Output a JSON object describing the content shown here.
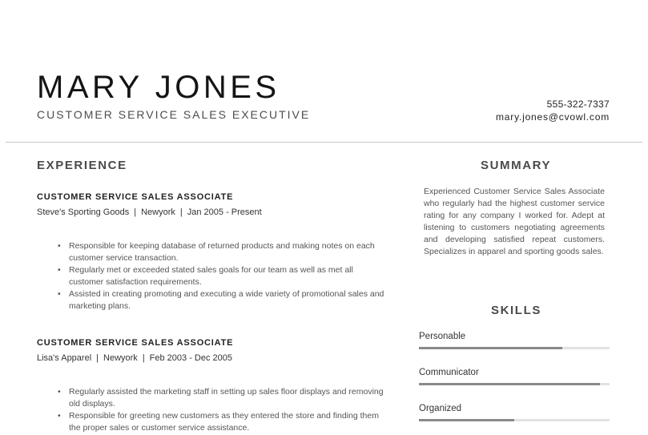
{
  "header": {
    "name": "MARY JONES",
    "title": "CUSTOMER SERVICE SALES EXECUTIVE",
    "phone": "555-322-7337",
    "email": "mary.jones@cvowl.com"
  },
  "experience": {
    "heading": "EXPERIENCE",
    "jobs": [
      {
        "title": "CUSTOMER SERVICE SALES ASSOCIATE",
        "company": "Steve's Sporting Goods",
        "location": "Newyork",
        "dates": "Jan 2005 - Present",
        "bullets": [
          "Responsible for keeping database of returned products and making notes on each customer service transaction.",
          "Regularly met or exceeded stated sales goals for our team as well as met all customer satisfaction requirements.",
          "Assisted in creating promoting and executing a wide variety of promotional sales and marketing plans."
        ]
      },
      {
        "title": "CUSTOMER SERVICE SALES ASSOCIATE",
        "company": "Lisa's Apparel",
        "location": "Newyork",
        "dates": "Feb 2003 - Dec 2005",
        "bullets": [
          "Regularly assisted the marketing staff in setting up sales floor displays and removing old displays.",
          "Responsible for greeting new customers as they entered the store and finding them the proper sales or customer service assistance."
        ]
      }
    ]
  },
  "summary": {
    "heading": "SUMMARY",
    "text": "Experienced Customer Service Sales Associate who regularly had the highest customer service rating for any company I worked for. Adept at listening to customers negotiating agreements and developing satisfied repeat customers. Specializes in apparel and sporting goods sales."
  },
  "skills": {
    "heading": "SKILLS",
    "items": [
      {
        "label": "Personable",
        "level": 0.75
      },
      {
        "label": "Communicator",
        "level": 0.95
      },
      {
        "label": "Organized",
        "level": 0.5
      }
    ]
  }
}
